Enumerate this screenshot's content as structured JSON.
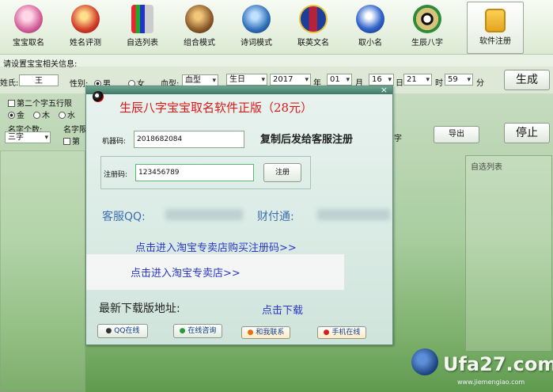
{
  "toolbar": {
    "items": [
      {
        "label": "宝宝取名",
        "icon": "baby-icon",
        "color": "#d45f9a"
      },
      {
        "label": "姓名评测",
        "icon": "gift-icon",
        "color": "#d23a2a"
      },
      {
        "label": "自选列表",
        "icon": "pencil-cup-icon",
        "color": "#8c8c8c"
      },
      {
        "label": "组合模式",
        "icon": "dragon-icon",
        "color": "#8a5a2a"
      },
      {
        "label": "诗词模式",
        "icon": "book-icon",
        "color": "#2f6fb8"
      },
      {
        "label": "联英文名",
        "icon": "barcelona-badge-icon",
        "color": "#b5223a"
      },
      {
        "label": "取小名",
        "icon": "owl-icon",
        "color": "#3366cc"
      },
      {
        "label": "生辰八字",
        "icon": "bagua-icon",
        "color": "#2e8b3a"
      },
      {
        "label": "软件注册",
        "icon": "lock-icon",
        "color": "#e0a21a"
      }
    ]
  },
  "form": {
    "heading": "请设置宝宝相关信息:",
    "surname_label": "姓氏:",
    "surname_value": "王",
    "gender_label": "性别:",
    "gender_male": "男",
    "gender_female": "女",
    "blood_label": "血型:",
    "blood_value": "血型",
    "birthday_value": "生日",
    "year_value": "2017",
    "year_unit": "年",
    "month_value": "01",
    "month_unit": "月",
    "day_value": "16",
    "day_unit": "日",
    "hour_value": "21",
    "hour_unit": "时",
    "minute_value": "59",
    "minute_unit": "分",
    "generate_button": "生成",
    "second_char_label": "第二个字五行限",
    "element_gold": "金",
    "element_wood": "木",
    "element_water": "水",
    "name_count_label": "名字个数:",
    "name_count_value": "三字",
    "name_limit_label": "名字限",
    "limit_option": "第",
    "partial_text": "字",
    "export_button": "导出",
    "stop_button": "停止",
    "zixuan_label": "自选列表"
  },
  "dialog": {
    "title": "生辰八字宝宝取名软件正版（28元）",
    "machine_label": "机器码:",
    "machine_value": "2018682084",
    "copy_hint": "复制后发给客服注册",
    "reg_label": "注册码:",
    "reg_value": "123456789",
    "reg_button": "注册",
    "qq_label": "客服QQ:",
    "alipay_label": "财付通:",
    "taobao_buy_link": "点击进入淘宝专卖店购买注册码>>",
    "taobao_link": "点击进入淘宝专卖店>>",
    "download_label": "最新下载版地址:",
    "download_link": "点击下载",
    "buttons": [
      {
        "label": "QQ在线",
        "icon": "qq-icon"
      },
      {
        "label": "在线咨询",
        "icon": "chat-icon"
      },
      {
        "label": "和我联系",
        "icon": "contact-icon"
      },
      {
        "label": "手机在线",
        "icon": "phone-icon"
      }
    ],
    "close_glyph": "×"
  },
  "watermark": {
    "brand": "Ufa27.com",
    "url": "www.jiemengiao.com"
  },
  "colors": {
    "title_red": "#e01818",
    "link_blue": "#2a36c8",
    "label_blue": "#3c6fb0"
  }
}
